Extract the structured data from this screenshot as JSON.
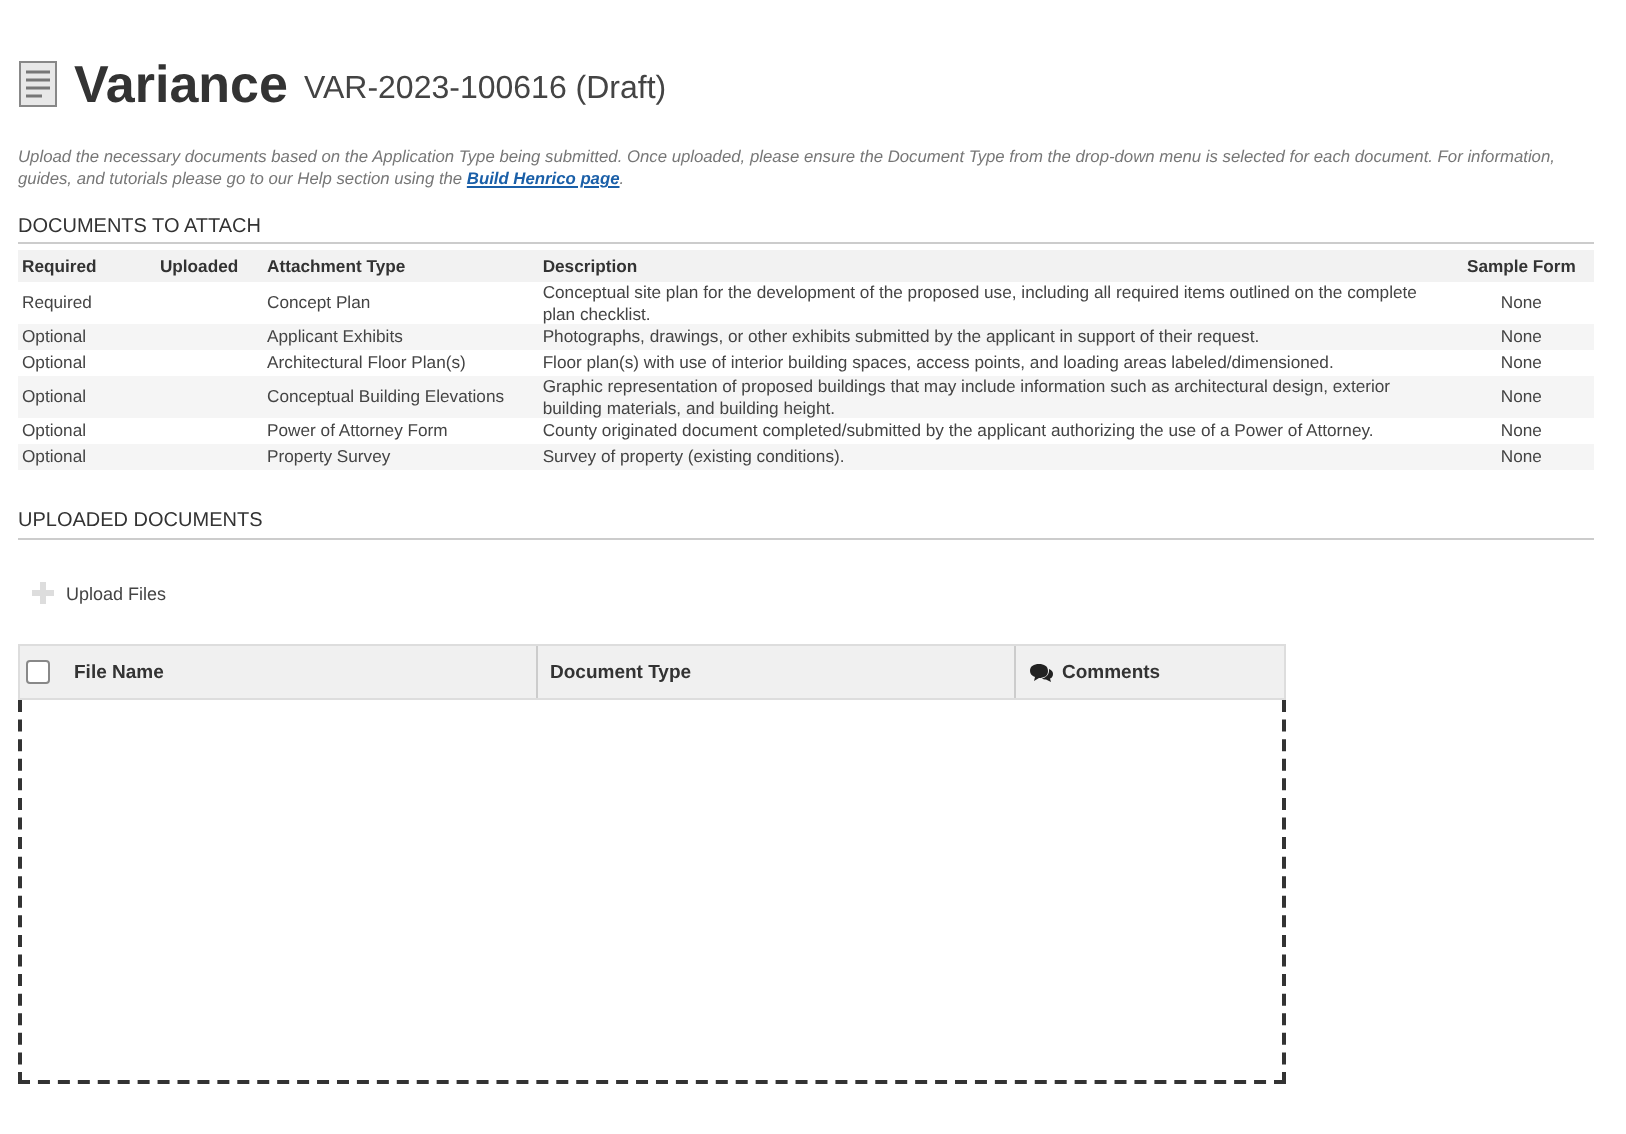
{
  "header": {
    "title": "Variance",
    "record": "VAR-2023-100616 (Draft)"
  },
  "intro": {
    "text": "Upload the necessary documents based on the Application Type being submitted. Once uploaded, please ensure the Document Type from the drop-down menu is selected for each document. For information, guides, and tutorials please go to our Help section using the",
    "link": "Build Henrico page",
    "after": "."
  },
  "attach": {
    "heading": "DOCUMENTS TO ATTACH",
    "columns": [
      "Required",
      "Uploaded",
      "Attachment Type",
      "Description",
      "Sample Form"
    ],
    "rows": [
      {
        "required": "Required",
        "type": "Concept Plan",
        "description": "Conceptual site plan for the development of the proposed use, including all required items outlined on the complete plan checklist.",
        "sample": "None"
      },
      {
        "required": "Optional",
        "type": "Applicant Exhibits",
        "description": "Photographs, drawings, or other exhibits submitted by the applicant in support of their request.",
        "sample": "None"
      },
      {
        "required": "Optional",
        "type": "Architectural Floor Plan(s)",
        "description": "Floor plan(s) with use of interior building spaces, access points, and loading areas labeled/dimensioned.",
        "sample": "None"
      },
      {
        "required": "Optional",
        "type": "Conceptual Building Elevations",
        "description": "Graphic representation of proposed buildings that may include information such as architectural design, exterior building materials, and building height.",
        "sample": "None"
      },
      {
        "required": "Optional",
        "type": "Power of Attorney Form",
        "description": "County originated document completed/submitted by the applicant authorizing the use of a Power of Attorney.",
        "sample": "None"
      },
      {
        "required": "Optional",
        "type": "Property Survey",
        "description": "Survey of property (existing conditions).",
        "sample": "None"
      }
    ]
  },
  "uploaded": {
    "heading": "UPLOADED DOCUMENTS",
    "upload_button": "Upload Files",
    "select_all": {
      "checked": false
    },
    "columns": [
      "File Name",
      "Document Type",
      "Comments"
    ]
  }
}
